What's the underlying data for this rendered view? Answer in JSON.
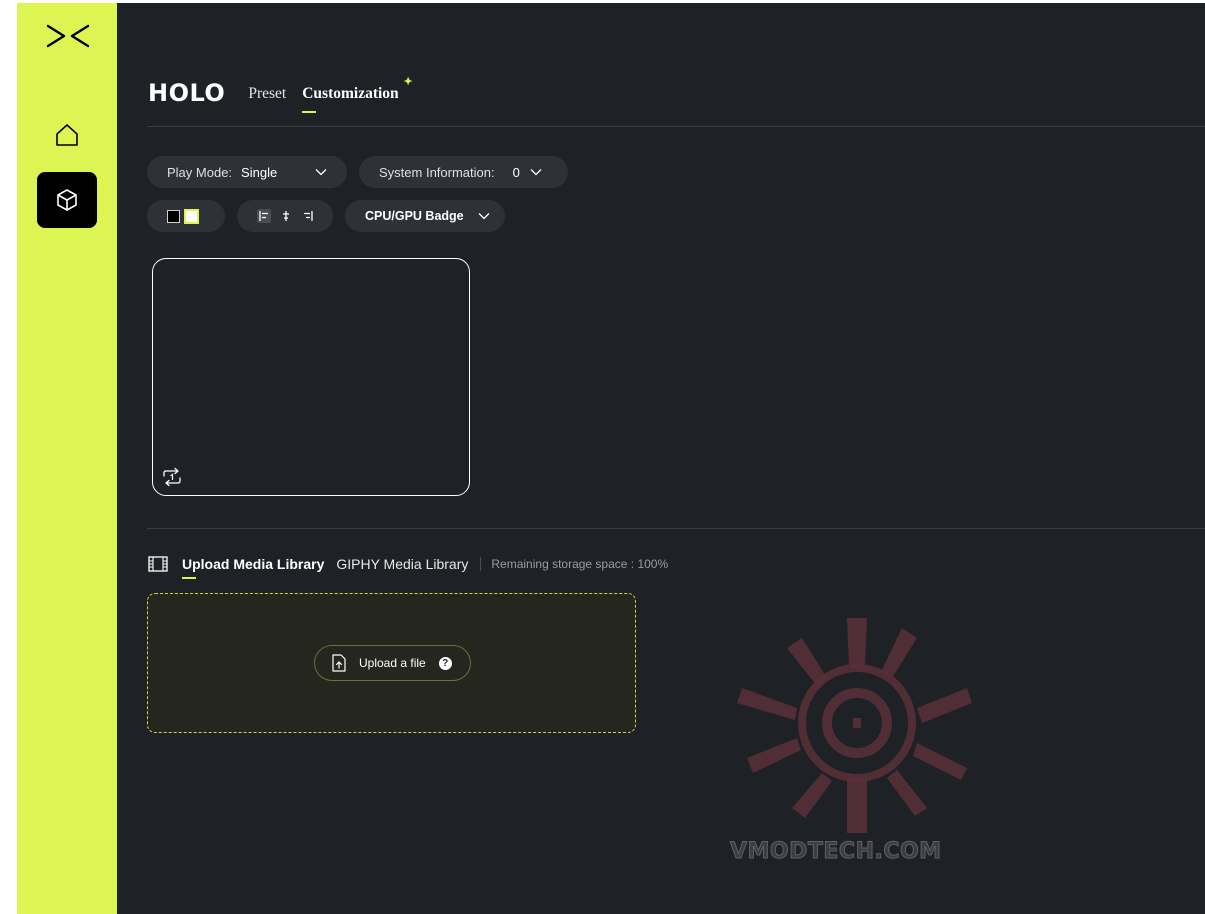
{
  "sidebar": {
    "logo_icon": "sideways-x-logo-icon",
    "items": [
      {
        "name": "home",
        "icon": "home-icon"
      },
      {
        "name": "customization",
        "icon": "cube-icon",
        "active": true
      }
    ]
  },
  "header": {
    "brand": "HOLO",
    "tabs": [
      {
        "label": "Preset"
      },
      {
        "label": "Customization",
        "active": true
      }
    ]
  },
  "controls": {
    "play_mode": {
      "label": "Play Mode:",
      "value": "Single"
    },
    "system_info": {
      "label": "System Information:",
      "value": "0"
    },
    "badge": {
      "label": "CPU/GPU Badge"
    }
  },
  "media": {
    "tabs": [
      {
        "label": "Upload Media Library",
        "active": true
      },
      {
        "label": "GIPHY Media Library"
      }
    ],
    "storage_text": "Remaining storage space : 100%",
    "upload_label": "Upload a file",
    "help_glyph": "?"
  },
  "watermark": {
    "text": "VMODTECH.COM"
  },
  "colors": {
    "accent": "#ddf552",
    "background": "#1e2126",
    "pill": "#2e3137"
  }
}
